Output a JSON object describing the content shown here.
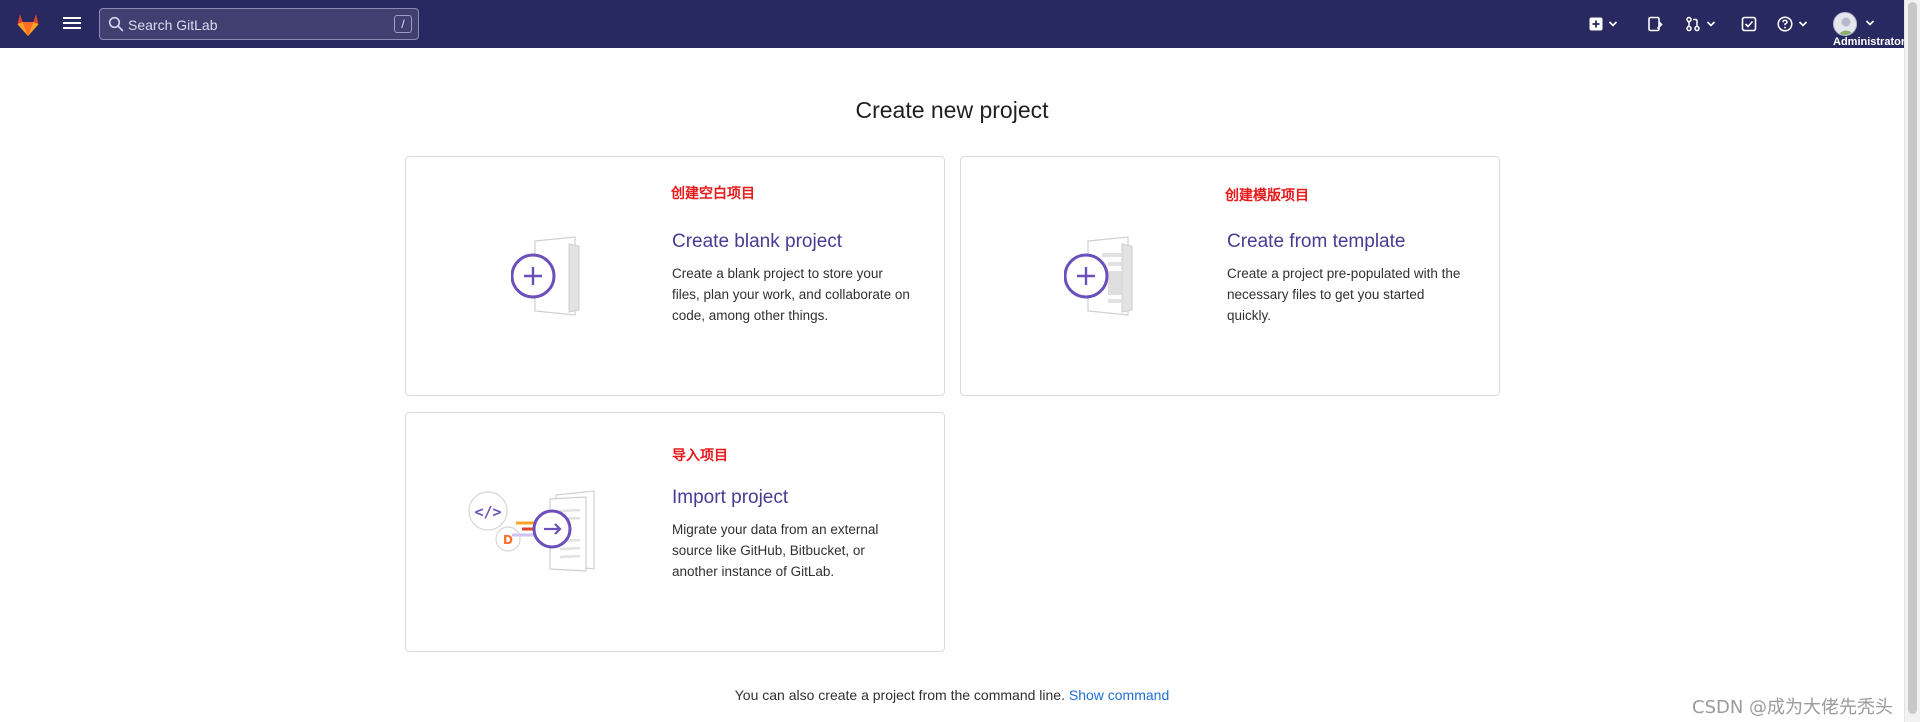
{
  "navbar": {
    "search_placeholder": "Search GitLab",
    "search_shortcut": "/",
    "user_label": "Administrator",
    "icons": [
      "gitlab-logo",
      "hamburger-menu-icon",
      "search-icon",
      "new-item-icon",
      "issues-icon",
      "merge-requests-icon",
      "todos-icon",
      "help-icon",
      "avatar"
    ],
    "background_color": "#292961"
  },
  "main": {
    "title": "Create new project",
    "cards": [
      {
        "annotation": "创建空白项目",
        "title": "Create blank project",
        "description": "Create a blank project to store your files, plan your work, and collaborate on code, among other things."
      },
      {
        "annotation": "创建模版项目",
        "title": "Create from template",
        "description": "Create a project pre-populated with the necessary files to get you started quickly."
      },
      {
        "annotation": "导入项目",
        "title": "Import project",
        "description": "Migrate your data from an external source like GitHub, Bitbucket, or another instance of GitLab."
      }
    ],
    "cli_text": "You can also create a project from the command line.",
    "cli_link": "Show command"
  },
  "watermark": "CSDN @成为大佬先秃头",
  "colors": {
    "accent": "#4a3a94",
    "annotation": "#e6191b",
    "link": "#1f6ed4"
  }
}
